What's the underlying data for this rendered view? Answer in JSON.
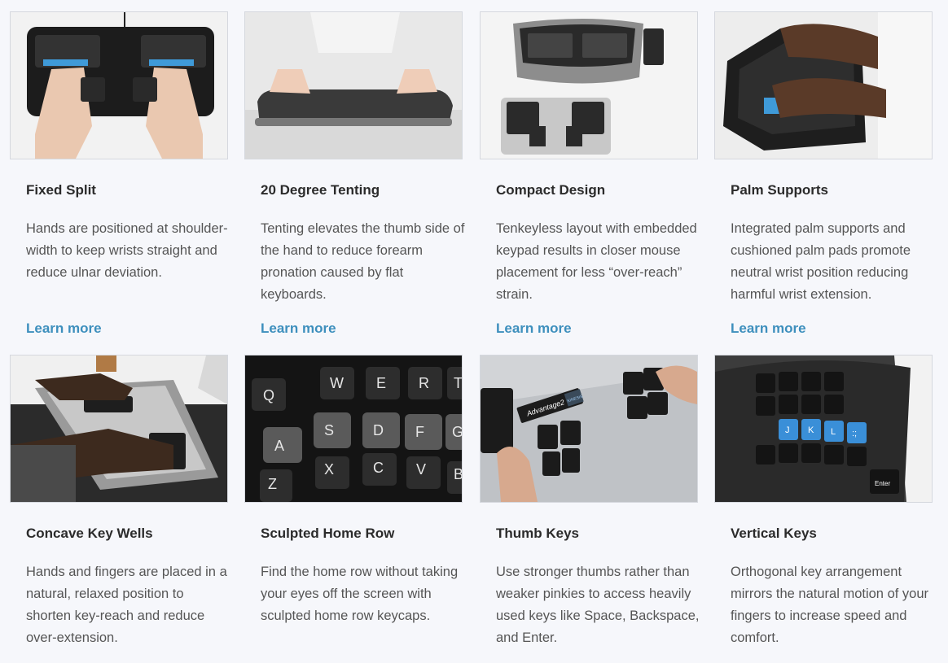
{
  "features": [
    {
      "title": "Fixed Split",
      "description": "Hands are positioned at shoulder-width to keep wrists straight and reduce ulnar deviation.",
      "link": "Learn more"
    },
    {
      "title": "20 Degree Tenting",
      "description": "Tenting elevates the thumb side of the hand to reduce forearm pronation caused by flat keyboards.",
      "link": "Learn more"
    },
    {
      "title": "Compact Design",
      "description": "Tenkeyless layout with embedded keypad results in closer mouse placement for less “over-reach” strain.",
      "link": "Learn more"
    },
    {
      "title": "Palm Supports",
      "description": "Integrated palm supports and cushioned palm pads promote neutral wrist position reducing harmful wrist extension.",
      "link": "Learn more"
    },
    {
      "title": "Concave Key Wells",
      "description": "Hands and fingers are placed in a natural, relaxed position to shorten key-reach and reduce over-extension."
    },
    {
      "title": "Sculpted Home Row",
      "description": "Find the home row without taking your eyes off the screen with sculpted home row keycaps."
    },
    {
      "title": "Thumb Keys",
      "description": "Use stronger thumbs rather than weaker pinkies to access heavily used keys like Space, Backspace, and Enter."
    },
    {
      "title": "Vertical Keys",
      "description": "Orthogonal key arrangement mirrors the natural motion of your fingers to increase speed and comfort."
    }
  ],
  "images": {
    "keycaps_row1": [
      "W",
      "E",
      "R",
      "T"
    ],
    "keycaps_row2": [
      "A",
      "S",
      "D",
      "F",
      "G"
    ],
    "keycaps_row0": [
      "Q"
    ],
    "keycaps_row3": [
      "Z",
      "X",
      "C",
      "V",
      "B"
    ],
    "brand_label": "Advantage2",
    "brand_badge": "KINESIS",
    "vertical_keys": [
      "J",
      "K",
      "L",
      ":;"
    ],
    "enter_key": "Enter"
  },
  "colors": {
    "background": "#f6f7fb",
    "link": "#3d8fbd",
    "accent_key": "#3a8fd8"
  }
}
